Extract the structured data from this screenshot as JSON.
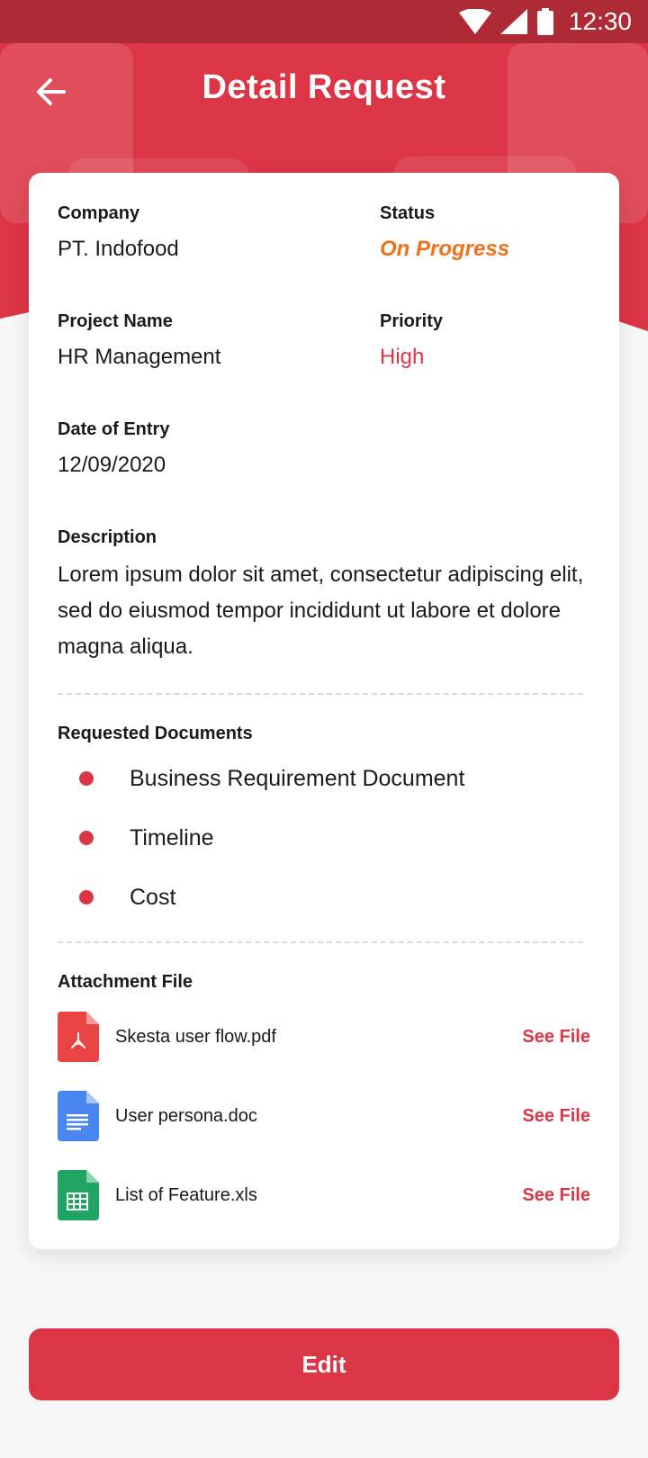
{
  "statusbar": {
    "time": "12:30",
    "icons": [
      "wifi-icon",
      "signal-icon",
      "battery-icon"
    ]
  },
  "header": {
    "title": "Detail Request",
    "back_icon": "arrow-left-icon"
  },
  "details": {
    "company": {
      "label": "Company",
      "value": "PT. Indofood"
    },
    "status": {
      "label": "Status",
      "value": "On Progress",
      "color": "#F0711C"
    },
    "project_name": {
      "label": "Project Name",
      "value": "HR Management"
    },
    "priority": {
      "label": "Priority",
      "value": "High",
      "color": "#DC3545"
    },
    "date_of_entry": {
      "label": "Date of Entry",
      "value": "12/09/2020"
    },
    "description": {
      "label": "Description",
      "value": "Lorem ipsum dolor sit amet, consectetur adipiscing elit, sed do eiusmod tempor incididunt ut labore et dolore magna aliqua."
    }
  },
  "requested_documents": {
    "label": "Requested Documents",
    "items": [
      "Business Requirement Document",
      "Timeline",
      "Cost"
    ]
  },
  "attachments": {
    "label": "Attachment File",
    "items": [
      {
        "name": "Skesta user flow.pdf",
        "action": "See File",
        "icon": "pdf-file-icon"
      },
      {
        "name": "User persona.doc",
        "action": "See File",
        "icon": "doc-file-icon"
      },
      {
        "name": "List of Feature.xls",
        "action": "See File",
        "icon": "sheet-file-icon"
      }
    ]
  },
  "actions": {
    "edit_label": "Edit"
  },
  "colors": {
    "primary": "#DC3545",
    "statusbar": "#AE2A34",
    "status_orange": "#F0711C",
    "pdf": "#E94444",
    "doc": "#4A86F0",
    "sheet": "#1FA463"
  }
}
